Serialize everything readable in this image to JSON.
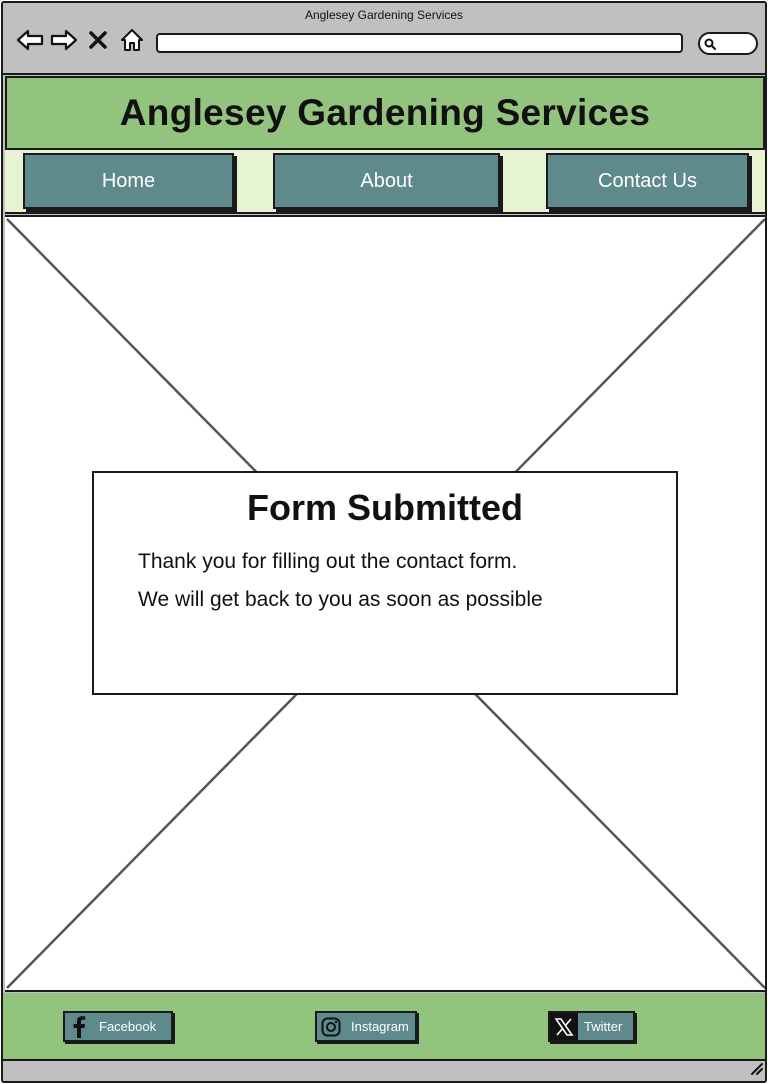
{
  "window": {
    "title": "Anglesey Gardening Services"
  },
  "header": {
    "title": "Anglesey Gardening Services"
  },
  "nav": {
    "items": [
      {
        "label": "Home"
      },
      {
        "label": "About"
      },
      {
        "label": "Contact Us"
      }
    ]
  },
  "message": {
    "title": "Form Submitted",
    "line1": "Thank you for filling out the contact form.",
    "line2": "We will get back to you as soon as possible"
  },
  "footer": {
    "social": [
      {
        "label": "Facebook",
        "icon": "facebook-icon"
      },
      {
        "label": "Instagram",
        "icon": "instagram-icon"
      },
      {
        "label": "Twitter",
        "icon": "x-twitter-icon"
      }
    ]
  },
  "colors": {
    "header_green": "#93c47d",
    "nav_background": "#e6f4d4",
    "button_teal": "#5f8a8b",
    "chrome_gray": "#c0c0c0"
  }
}
